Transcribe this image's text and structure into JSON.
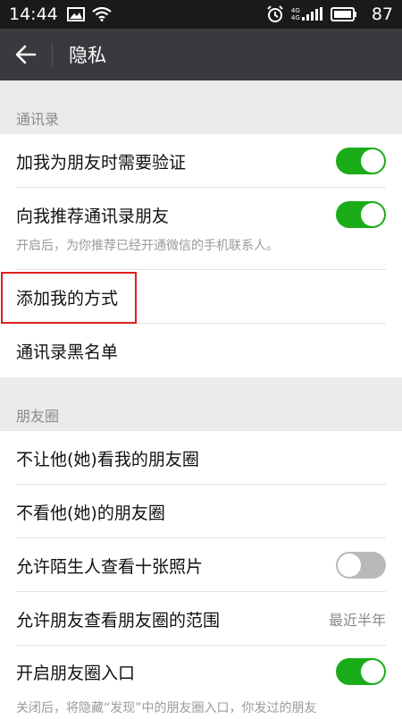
{
  "status_bar": {
    "time": "14:44",
    "network_top": "4G",
    "network_bottom": "4G",
    "battery": "87",
    "icons": [
      "image-icon",
      "wifi-icon",
      "alarm-icon",
      "signal-icon",
      "battery-icon"
    ]
  },
  "header": {
    "title": "隐私",
    "back_icon": "arrow-left-icon"
  },
  "sections": {
    "contacts": {
      "title": "通讯录",
      "items": [
        {
          "label": "加我为朋友时需要验证",
          "toggle": true
        },
        {
          "label": "向我推荐通讯录朋友",
          "toggle": true,
          "sub": "开启后，为你推荐已经开通微信的手机联系人。"
        },
        {
          "label": "添加我的方式",
          "highlighted": true
        },
        {
          "label": "通讯录黑名单"
        }
      ]
    },
    "moments": {
      "title": "朋友圈",
      "items": [
        {
          "label": "不让他(她)看我的朋友圈"
        },
        {
          "label": "不看他(她)的朋友圈"
        },
        {
          "label": "允许陌生人查看十张照片",
          "toggle": false
        },
        {
          "label": "允许朋友查看朋友圈的范围",
          "value": "最近半年"
        },
        {
          "label": "开启朋友圈入口",
          "toggle": true
        }
      ],
      "footer_note": "关闭后，将隐藏“发现”中的朋友圈入口，你发过的朋友"
    }
  },
  "colors": {
    "accent": "#1aad19",
    "highlight": "#e02020",
    "action_bar": "#393a3e"
  }
}
